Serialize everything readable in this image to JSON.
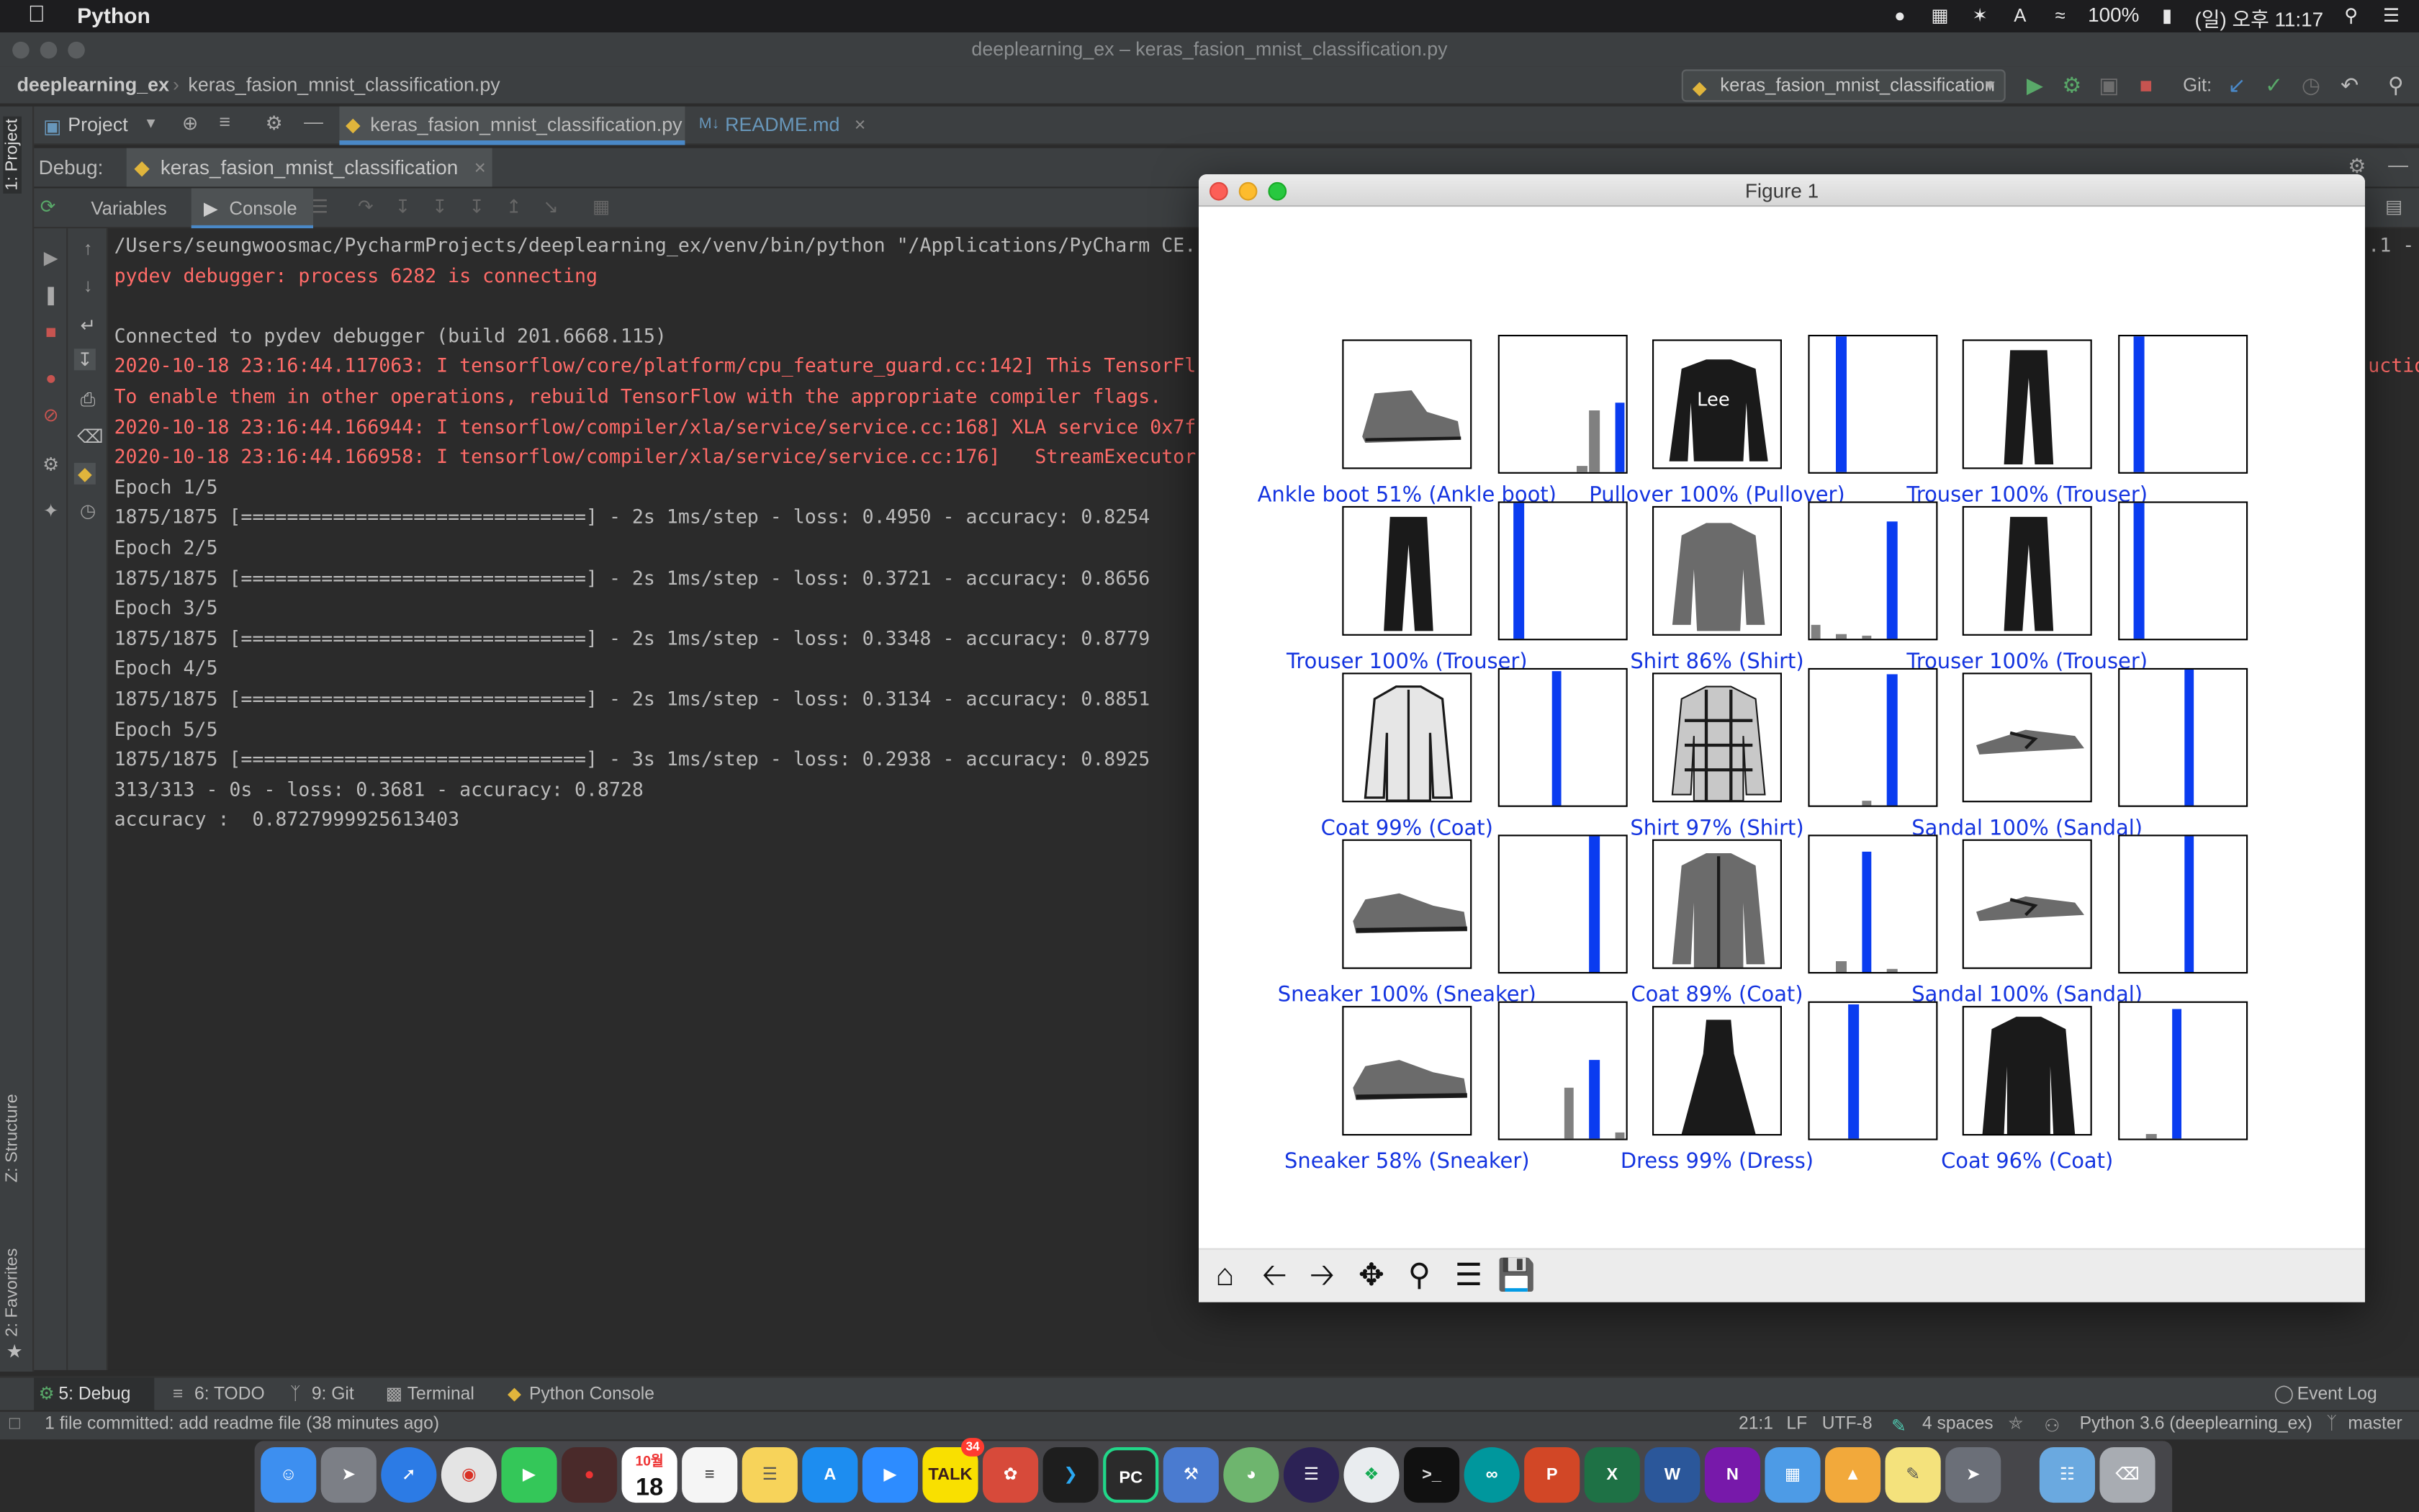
{
  "menubar": {
    "app_name": "Python",
    "battery": "100%",
    "clock": "(일) 오후 11:17"
  },
  "window": {
    "title": "deeplearning_ex – keras_fasion_mnist_classification.py"
  },
  "navbar": {
    "project": "deeplearning_ex",
    "file": "keras_fasion_mnist_classification.py",
    "run_config": "keras_fasion_mnist_classification",
    "git_label": "Git:"
  },
  "project_tool": {
    "label": "Project"
  },
  "editor_tabs": [
    {
      "label": "keras_fasion_mnist_classification.py"
    },
    {
      "label": "README.md"
    }
  ],
  "left_stripe": {
    "project": "1: Project",
    "structure": "Z: Structure",
    "favorites": "2: Favorites"
  },
  "debug": {
    "label": "Debug:",
    "session_tab": "keras_fasion_mnist_classification",
    "tabs": [
      "Variables",
      "Console"
    ]
  },
  "console": {
    "lines": [
      {
        "text": "/Users/seungwoosmac/PycharmProjects/deeplearning_ex/venv/bin/python \"/Applications/PyCharm CE.",
        "color": "normal"
      },
      {
        "text": "pydev debugger: process 6282 is connecting",
        "color": "red"
      },
      {
        "text": "",
        "color": "normal"
      },
      {
        "text": "Connected to pydev debugger (build 201.6668.115)",
        "color": "normal"
      },
      {
        "text": "2020-10-18 23:16:44.117063: I tensorflow/core/platform/cpu_feature_guard.cc:142] This TensorFl",
        "color": "red"
      },
      {
        "text": "To enable them in other operations, rebuild TensorFlow with the appropriate compiler flags.",
        "color": "red"
      },
      {
        "text": "2020-10-18 23:16:44.166944: I tensorflow/compiler/xla/service/service.cc:168] XLA service 0x7f",
        "color": "red"
      },
      {
        "text": "2020-10-18 23:16:44.166958: I tensorflow/compiler/xla/service/service.cc:176]   StreamExecutor",
        "color": "red"
      },
      {
        "text": "Epoch 1/5",
        "color": "normal"
      },
      {
        "text": "1875/1875 [==============================] - 2s 1ms/step - loss: 0.4950 - accuracy: 0.8254",
        "color": "normal"
      },
      {
        "text": "Epoch 2/5",
        "color": "normal"
      },
      {
        "text": "1875/1875 [==============================] - 2s 1ms/step - loss: 0.3721 - accuracy: 0.8656",
        "color": "normal"
      },
      {
        "text": "Epoch 3/5",
        "color": "normal"
      },
      {
        "text": "1875/1875 [==============================] - 2s 1ms/step - loss: 0.3348 - accuracy: 0.8779",
        "color": "normal"
      },
      {
        "text": "Epoch 4/5",
        "color": "normal"
      },
      {
        "text": "1875/1875 [==============================] - 2s 1ms/step - loss: 0.3134 - accuracy: 0.8851",
        "color": "normal"
      },
      {
        "text": "Epoch 5/5",
        "color": "normal"
      },
      {
        "text": "1875/1875 [==============================] - 3s 1ms/step - loss: 0.2938 - accuracy: 0.8925",
        "color": "normal"
      },
      {
        "text": "313/313 - 0s - loss: 0.3681 - accuracy: 0.8728",
        "color": "normal"
      },
      {
        "text": "accuracy :  0.8727999925613403",
        "color": "normal"
      }
    ],
    "right_fragments": {
      "line1": ".1 -",
      "line5": "uctio"
    }
  },
  "figure": {
    "title": "Figure 1",
    "toolbar": [
      "home-icon",
      "back-icon",
      "forward-icon",
      "pan-icon",
      "zoom-icon",
      "configure-icon",
      "save-icon"
    ],
    "cells": [
      {
        "label": "Ankle boot 51% (Ankle boot)",
        "garment": "ankle-boot-image",
        "bars": [
          [
            6,
            0.05,
            "gray"
          ],
          [
            7,
            0.45,
            "gray"
          ],
          [
            9,
            0.51,
            "blue"
          ]
        ]
      },
      {
        "label": "Pullover 100% (Pullover)",
        "garment": "pullover-image",
        "bars": [
          [
            2,
            1.0,
            "blue"
          ]
        ]
      },
      {
        "label": "Trouser 100% (Trouser)",
        "garment": "trouser-image",
        "bars": [
          [
            1,
            1.0,
            "blue"
          ]
        ]
      },
      {
        "label": "Trouser 100% (Trouser)",
        "garment": "trouser-image",
        "bars": [
          [
            1,
            1.0,
            "blue"
          ]
        ]
      },
      {
        "label": "Shirt 86% (Shirt)",
        "garment": "shirt-image",
        "bars": [
          [
            0,
            0.1,
            "gray"
          ],
          [
            2,
            0.03,
            "gray"
          ],
          [
            4,
            0.02,
            "gray"
          ],
          [
            6,
            0.86,
            "blue"
          ]
        ]
      },
      {
        "label": "Trouser 100% (Trouser)",
        "garment": "trouser-image",
        "bars": [
          [
            1,
            1.0,
            "blue"
          ]
        ]
      },
      {
        "label": "Coat 99% (Coat)",
        "garment": "coat-image",
        "bars": [
          [
            4,
            0.99,
            "blue"
          ]
        ]
      },
      {
        "label": "Shirt 97% (Shirt)",
        "garment": "plaid-shirt-image",
        "bars": [
          [
            4,
            0.03,
            "gray"
          ],
          [
            6,
            0.97,
            "blue"
          ]
        ]
      },
      {
        "label": "Sandal 100% (Sandal)",
        "garment": "sandal-image",
        "bars": [
          [
            5,
            1.0,
            "blue"
          ]
        ]
      },
      {
        "label": "Sneaker 100% (Sneaker)",
        "garment": "sneaker-image",
        "bars": [
          [
            7,
            1.0,
            "blue"
          ]
        ]
      },
      {
        "label": "Coat 89% (Coat)",
        "garment": "jacket-image",
        "bars": [
          [
            2,
            0.08,
            "gray"
          ],
          [
            4,
            0.89,
            "blue"
          ],
          [
            6,
            0.02,
            "gray"
          ]
        ]
      },
      {
        "label": "Sandal 100% (Sandal)",
        "garment": "sandal-image",
        "bars": [
          [
            5,
            1.0,
            "blue"
          ]
        ]
      },
      {
        "label": "Sneaker 58% (Sneaker)",
        "garment": "sneaker-image",
        "bars": [
          [
            5,
            0.38,
            "gray"
          ],
          [
            7,
            0.58,
            "blue"
          ],
          [
            9,
            0.04,
            "gray"
          ]
        ]
      },
      {
        "label": "Dress 99% (Dress)",
        "garment": "dress-image",
        "bars": [
          [
            3,
            0.99,
            "blue"
          ]
        ]
      },
      {
        "label": "Coat 96% (Coat)",
        "garment": "coat-dark-image",
        "bars": [
          [
            2,
            0.03,
            "gray"
          ],
          [
            4,
            0.96,
            "blue"
          ]
        ]
      }
    ]
  },
  "bottom_tabs": [
    {
      "label": "5: Debug"
    },
    {
      "label": "6: TODO"
    },
    {
      "label": "9: Git"
    },
    {
      "label": "Terminal"
    },
    {
      "label": "Python Console"
    }
  ],
  "event_log": "Event Log",
  "status": {
    "message": "1 file committed: add readme file (38 minutes ago)",
    "position": "21:1",
    "line_sep": "LF",
    "encoding": "UTF-8",
    "indent": "4 spaces",
    "interpreter": "Python 3.6 (deeplearning_ex)",
    "branch": "master"
  },
  "dock": {
    "calendar_day": "18",
    "calendar_month": "10월",
    "talk_badge": "34"
  },
  "colors": {
    "console_error": "#ff6b68",
    "prediction_blue": "#1434e0",
    "accent": "#4a88c7"
  }
}
